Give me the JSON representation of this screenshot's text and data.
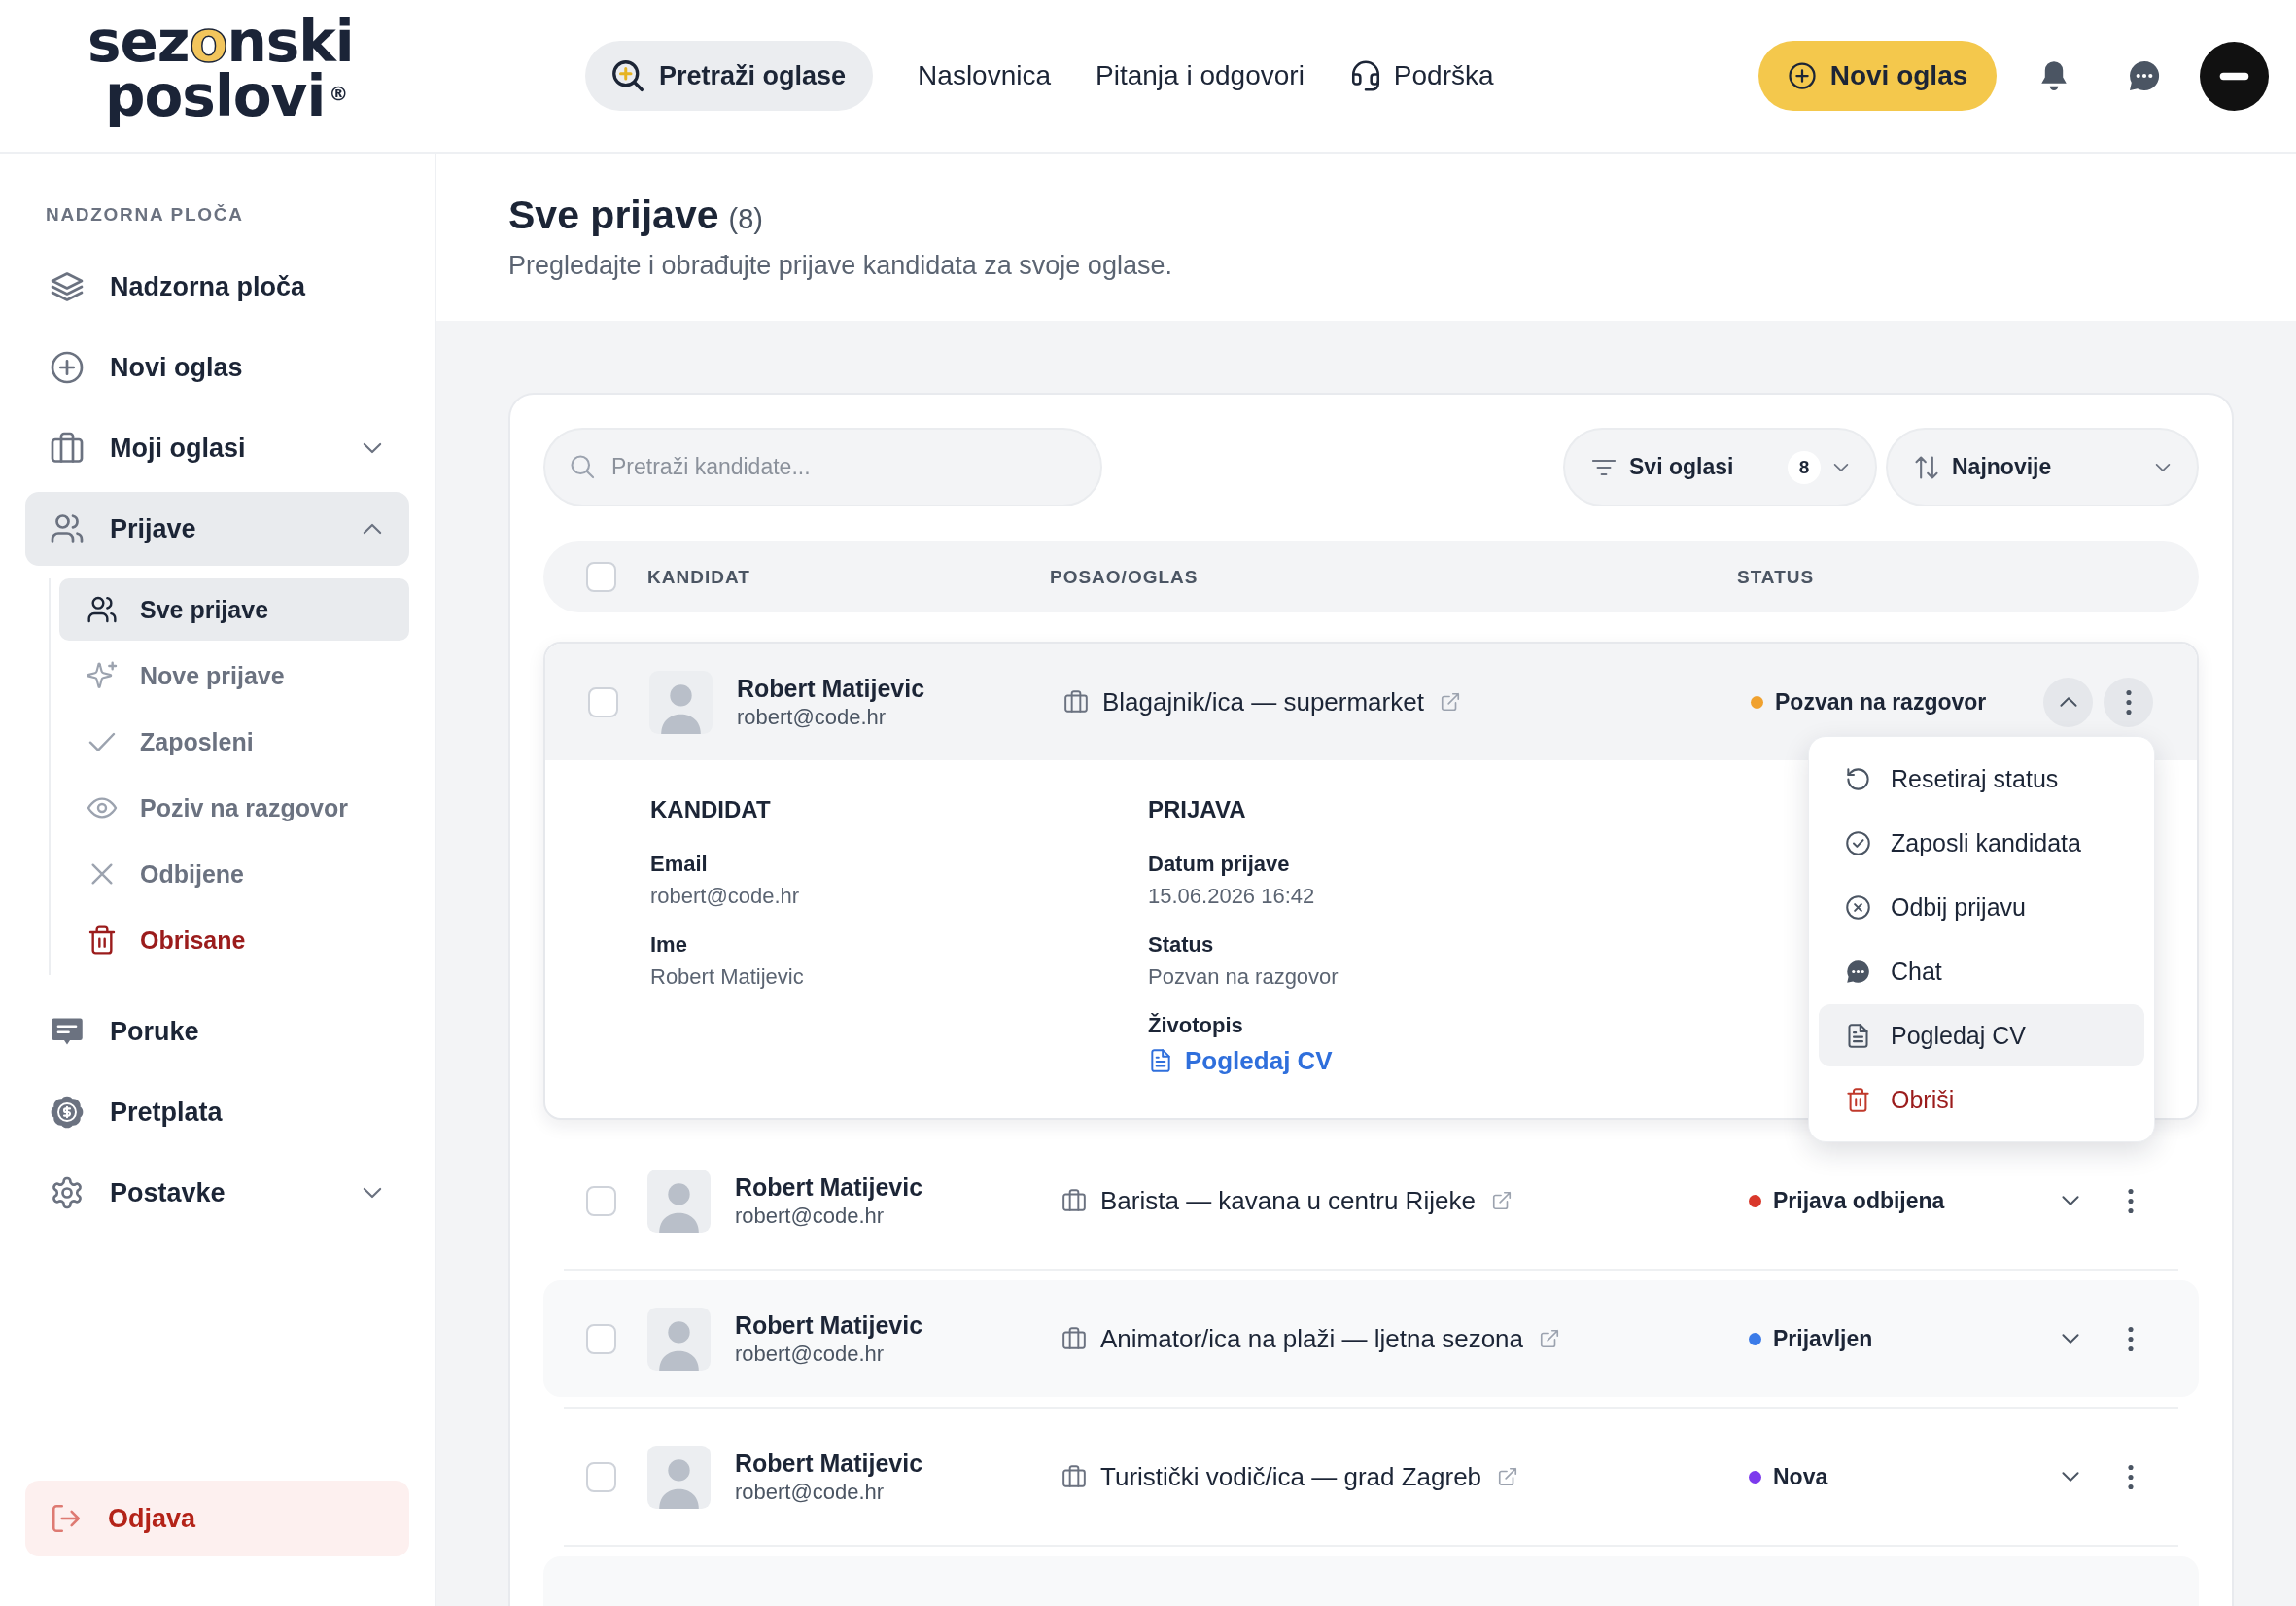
{
  "header": {
    "logo": {
      "line_1": "sezonski",
      "line_2": "poslovi",
      "mark": "®"
    },
    "search_button": "Pretraži oglase",
    "nav": [
      {
        "label": "Naslovnica",
        "kind": "link"
      },
      {
        "label": "Pitanja i odgovori",
        "kind": "link"
      },
      {
        "label": "Podrška",
        "kind": "support"
      }
    ],
    "new_ad_button": "Novi oglas"
  },
  "sidebar": {
    "section_label": "NADZORNA PLOČA",
    "items": [
      {
        "label": "Nadzorna ploča",
        "kind": "link",
        "selected": false
      },
      {
        "label": "Novi oglas",
        "kind": "link",
        "selected": false
      },
      {
        "label": "Moji oglasi",
        "kind": "group",
        "selected": false,
        "expanded": false
      },
      {
        "label": "Prijave",
        "kind": "group",
        "selected": true,
        "expanded": true,
        "children": [
          {
            "label": "Sve prijave",
            "kind": "filter",
            "selected": true
          },
          {
            "label": "Nove prijave",
            "kind": "filter",
            "selected": false
          },
          {
            "label": "Zaposleni",
            "kind": "filter",
            "selected": false
          },
          {
            "label": "Poziv na razgovor",
            "kind": "filter",
            "selected": false
          },
          {
            "label": "Odbijene",
            "kind": "filter",
            "selected": false
          },
          {
            "label": "Obrisane",
            "kind": "danger",
            "selected": false
          }
        ]
      },
      {
        "label": "Poruke",
        "kind": "link",
        "selected": false
      },
      {
        "label": "Pretplata",
        "kind": "link",
        "selected": false
      },
      {
        "label": "Postavke",
        "kind": "group",
        "selected": false,
        "expanded": false
      }
    ],
    "logout_button": "Odjava"
  },
  "page": {
    "title": "Sve prijave",
    "count": "(8)",
    "subtitle": "Pregledajte i obrađujte prijave kandidata za svoje oglase."
  },
  "toolbar": {
    "search": {
      "placeholder": "Pretraži kandidate..."
    },
    "job_filter": {
      "value": "Svi oglasi",
      "count": "8"
    },
    "sort": {
      "value": "Najnovije"
    }
  },
  "table": {
    "select_all_checked": false,
    "columns": [
      "KANDIDAT",
      "POSAO/OGLAS",
      "STATUS"
    ],
    "rows": [
      {
        "name": "Robert Matijevic",
        "email": "robert@code.hr",
        "job": "Blagajnik/ica — supermarket",
        "status": "Pozvan na razgovor",
        "color": "#f0a12e",
        "checked": false,
        "expanded": true,
        "details": {
          "candidate_heading": "KANDIDAT",
          "candidate_fields": [
            {
              "label": "Email",
              "value": "robert@code.hr"
            },
            {
              "label": "Ime",
              "value": "Robert Matijevic"
            }
          ],
          "application_heading": "PRIJAVA",
          "application_fields": [
            {
              "label": "Datum prijave",
              "value": "15.06.2026 16:42"
            },
            {
              "label": "Status",
              "value": "Pozvan na razgovor"
            }
          ],
          "cv_label": "Životopis",
          "cv_link": "Pogledaj CV"
        },
        "menu": {
          "items": [
            {
              "label": "Resetiraj status",
              "kind": "action",
              "selected": false
            },
            {
              "label": "Zaposli kandidata",
              "kind": "action",
              "selected": false
            },
            {
              "label": "Odbij prijavu",
              "kind": "action",
              "selected": false
            },
            {
              "label": "Chat",
              "kind": "action",
              "selected": false
            },
            {
              "label": "Pogledaj CV",
              "kind": "action",
              "selected": true
            },
            {
              "label": "Obriši",
              "kind": "danger",
              "selected": false
            }
          ]
        }
      },
      {
        "name": "Robert Matijevic",
        "email": "robert@code.hr",
        "job": "Barista — kavana u centru Rijeke",
        "status": "Prijava odbijena",
        "color": "#d9382b",
        "checked": false,
        "expanded": false
      },
      {
        "name": "Robert Matijevic",
        "email": "robert@code.hr",
        "job": "Animator/ica na plaži — ljetna sezona",
        "status": "Prijavljen",
        "color": "#3b7be8",
        "checked": false,
        "expanded": false
      },
      {
        "name": "Robert Matijevic",
        "email": "robert@code.hr",
        "job": "Turistički vodič/ica — grad Zagreb",
        "status": "Nova",
        "color": "#7c3aed",
        "checked": false,
        "expanded": false
      }
    ]
  }
}
